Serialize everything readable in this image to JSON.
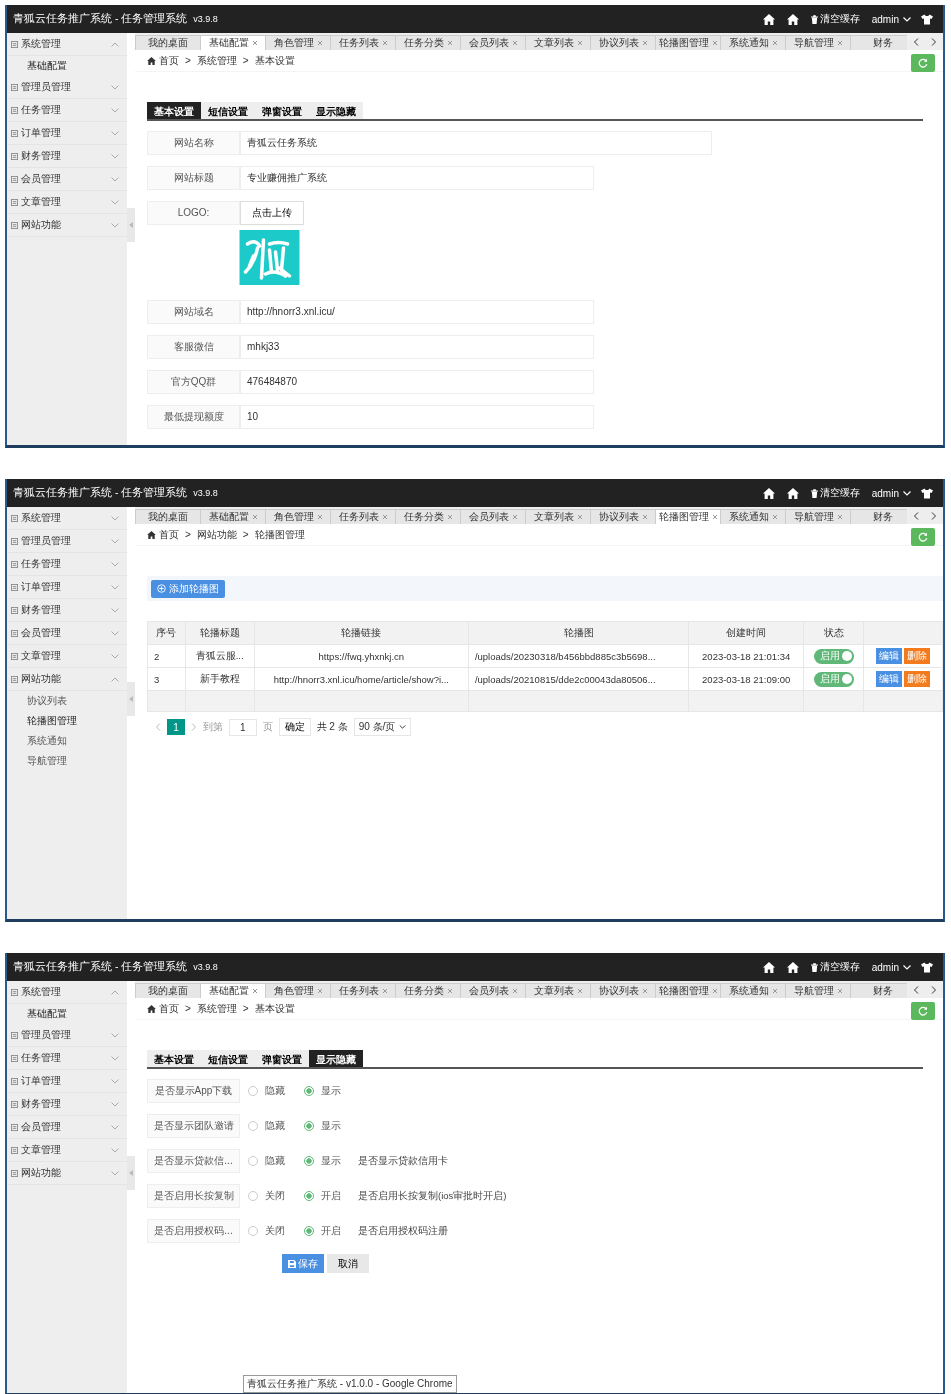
{
  "screens": [
    {
      "header": {
        "title": "青狐云任务推广系统 - 任务管理系统",
        "version": "v3.9.8",
        "clear_cache": "清空缓存",
        "user": "admin"
      },
      "sidebar": [
        {
          "label": "系统管理",
          "expanded": true,
          "children": [
            {
              "label": "基础配置",
              "selected": true
            }
          ]
        },
        {
          "label": "管理员管理",
          "expanded": false
        },
        {
          "label": "任务管理",
          "expanded": false
        },
        {
          "label": "订单管理",
          "expanded": false
        },
        {
          "label": "财务管理",
          "expanded": false
        },
        {
          "label": "会员管理",
          "expanded": false
        },
        {
          "label": "文章管理",
          "expanded": false
        },
        {
          "label": "网站功能",
          "expanded": false
        }
      ],
      "tabs": [
        {
          "label": "我的桌面",
          "selected": false,
          "closable": false
        },
        {
          "label": "基础配置",
          "selected": true,
          "closable": true
        },
        {
          "label": "角色管理",
          "selected": false,
          "closable": true
        },
        {
          "label": "任务列表",
          "selected": false,
          "closable": true
        },
        {
          "label": "任务分类",
          "selected": false,
          "closable": true
        },
        {
          "label": "会员列表",
          "selected": false,
          "closable": true
        },
        {
          "label": "文章列表",
          "selected": false,
          "closable": true
        },
        {
          "label": "协议列表",
          "selected": false,
          "closable": true
        },
        {
          "label": "轮播图管理",
          "selected": false,
          "closable": true
        },
        {
          "label": "系统通知",
          "selected": false,
          "closable": true
        },
        {
          "label": "导航管理",
          "selected": false,
          "closable": true
        },
        {
          "label": "财务",
          "selected": false,
          "closable": false
        }
      ],
      "breadcrumb": {
        "separator": ">",
        "items": [
          "首页",
          "系统管理",
          "基本设置"
        ]
      },
      "content": {
        "kind": "form",
        "subtabs": [
          {
            "label": "基本设置",
            "selected": true
          },
          {
            "label": "短信设置",
            "selected": false
          },
          {
            "label": "弹窗设置",
            "selected": false
          },
          {
            "label": "显示隐藏",
            "selected": false
          }
        ],
        "fields": [
          {
            "kind": "long",
            "label": "网站名称",
            "value": "青狐云任务系统"
          },
          {
            "kind": "text",
            "label": "网站标题",
            "value": "专业赚佣推广系统"
          },
          {
            "kind": "upload",
            "label": "LOGO:",
            "button": "点击上传"
          },
          {
            "kind": "text",
            "label": "网站域名",
            "value": "http://hnorr3.xnl.icu/"
          },
          {
            "kind": "text",
            "label": "客服微信",
            "value": "mhkj33"
          },
          {
            "kind": "text",
            "label": "官方QQ群",
            "value": "476484870"
          },
          {
            "kind": "text",
            "label": "最低提现额度",
            "value": "10"
          }
        ]
      }
    },
    {
      "header": {
        "title": "青狐云任务推广系统 - 任务管理系统",
        "version": "v3.9.8",
        "clear_cache": "清空缓存",
        "user": "admin"
      },
      "sidebar": [
        {
          "label": "系统管理",
          "expanded": false
        },
        {
          "label": "管理员管理",
          "expanded": false
        },
        {
          "label": "任务管理",
          "expanded": false
        },
        {
          "label": "订单管理",
          "expanded": false
        },
        {
          "label": "财务管理",
          "expanded": false
        },
        {
          "label": "会员管理",
          "expanded": false
        },
        {
          "label": "文章管理",
          "expanded": false
        },
        {
          "label": "网站功能",
          "expanded": true,
          "children": [
            {
              "label": "协议列表",
              "selected": false
            },
            {
              "label": "轮播图管理",
              "selected": true
            },
            {
              "label": "系统通知",
              "selected": false
            },
            {
              "label": "导航管理",
              "selected": false
            }
          ]
        }
      ],
      "tabs": [
        {
          "label": "我的桌面",
          "selected": false,
          "closable": false
        },
        {
          "label": "基础配置",
          "selected": false,
          "closable": true
        },
        {
          "label": "角色管理",
          "selected": false,
          "closable": true
        },
        {
          "label": "任务列表",
          "selected": false,
          "closable": true
        },
        {
          "label": "任务分类",
          "selected": false,
          "closable": true
        },
        {
          "label": "会员列表",
          "selected": false,
          "closable": true
        },
        {
          "label": "文章列表",
          "selected": false,
          "closable": true
        },
        {
          "label": "协议列表",
          "selected": false,
          "closable": true
        },
        {
          "label": "轮播图管理",
          "selected": true,
          "closable": true
        },
        {
          "label": "系统通知",
          "selected": false,
          "closable": true
        },
        {
          "label": "导航管理",
          "selected": false,
          "closable": true
        },
        {
          "label": "财务",
          "selected": false,
          "closable": false
        }
      ],
      "breadcrumb": {
        "separator": ">",
        "items": [
          "首页",
          "网站功能",
          "轮播图管理"
        ]
      },
      "content": {
        "kind": "table",
        "add_button": "添加轮播图",
        "columns": [
          "序号",
          "轮播标题",
          "轮播链接",
          "轮播图",
          "创建时间",
          "状态"
        ],
        "rows": [
          {
            "cells": [
              "2",
              "青狐云服...",
              "https://fwq.yhxnkj.cn",
              "/uploads/20230318/b456bbd885c3b5698...",
              "2023-03-18 21:01:34"
            ],
            "status": {
              "label": "启用",
              "on": true
            },
            "actions": [
              "编辑",
              "删除"
            ]
          },
          {
            "cells": [
              "3",
              "新手教程",
              "http://hnorr3.xnl.icu/home/article/show?i...",
              "/uploads/20210815/dde2c00043da80506...",
              "2023-03-18 21:09:00"
            ],
            "status": {
              "label": "启用",
              "on": true
            },
            "actions": [
              "编辑",
              "删除"
            ]
          }
        ],
        "pagination": {
          "page": "1",
          "goto": "到第",
          "input": "1",
          "unit": "页",
          "confirm": "确定",
          "total": "共 2 条",
          "per_page": "90 条/页"
        }
      }
    },
    {
      "header": {
        "title": "青狐云任务推广系统 - 任务管理系统",
        "version": "v3.9.8",
        "clear_cache": "清空缓存",
        "user": "admin"
      },
      "sidebar": [
        {
          "label": "系统管理",
          "expanded": true,
          "children": [
            {
              "label": "基础配置",
              "selected": true
            }
          ]
        },
        {
          "label": "管理员管理",
          "expanded": false
        },
        {
          "label": "任务管理",
          "expanded": false
        },
        {
          "label": "订单管理",
          "expanded": false
        },
        {
          "label": "财务管理",
          "expanded": false
        },
        {
          "label": "会员管理",
          "expanded": false
        },
        {
          "label": "文章管理",
          "expanded": false
        },
        {
          "label": "网站功能",
          "expanded": false
        }
      ],
      "tabs": [
        {
          "label": "我的桌面",
          "selected": false,
          "closable": false
        },
        {
          "label": "基础配置",
          "selected": true,
          "closable": true
        },
        {
          "label": "角色管理",
          "selected": false,
          "closable": true
        },
        {
          "label": "任务列表",
          "selected": false,
          "closable": true
        },
        {
          "label": "任务分类",
          "selected": false,
          "closable": true
        },
        {
          "label": "会员列表",
          "selected": false,
          "closable": true
        },
        {
          "label": "文章列表",
          "selected": false,
          "closable": true
        },
        {
          "label": "协议列表",
          "selected": false,
          "closable": true
        },
        {
          "label": "轮播图管理",
          "selected": false,
          "closable": true
        },
        {
          "label": "系统通知",
          "selected": false,
          "closable": true
        },
        {
          "label": "导航管理",
          "selected": false,
          "closable": true
        },
        {
          "label": "财务",
          "selected": false,
          "closable": false
        }
      ],
      "breadcrumb": {
        "separator": ">",
        "items": [
          "首页",
          "系统管理",
          "基本设置"
        ]
      },
      "content": {
        "kind": "form",
        "subtabs": [
          {
            "label": "基本设置",
            "selected": false
          },
          {
            "label": "短信设置",
            "selected": false
          },
          {
            "label": "弹窗设置",
            "selected": false
          },
          {
            "label": "显示隐藏",
            "selected": true
          }
        ],
        "fields": [
          {
            "kind": "radio",
            "label": "是否显示App下载",
            "options": [
              {
                "label": "隐藏",
                "selected": false
              },
              {
                "label": "显示",
                "selected": true
              }
            ]
          },
          {
            "kind": "radio",
            "label": "是否显示团队邀请",
            "options": [
              {
                "label": "隐藏",
                "selected": false
              },
              {
                "label": "显示",
                "selected": true
              }
            ]
          },
          {
            "kind": "radio",
            "label": "是否显示贷款信...",
            "options": [
              {
                "label": "隐藏",
                "selected": false
              },
              {
                "label": "显示",
                "selected": true
              }
            ],
            "note": "是否显示贷款信用卡"
          },
          {
            "kind": "radio",
            "label": "是否启用长按复制",
            "options": [
              {
                "label": "关闭",
                "selected": false
              },
              {
                "label": "开启",
                "selected": true
              }
            ],
            "note": "是否启用长按复制(ios审批时开启)"
          },
          {
            "kind": "radio",
            "label": "是否启用授权码...",
            "options": [
              {
                "label": "关闭",
                "selected": false
              },
              {
                "label": "开启",
                "selected": true
              }
            ],
            "note": "是否启用授权码注册"
          }
        ],
        "buttons": [
          {
            "label": "保存",
            "primary": true
          },
          {
            "label": "取消",
            "primary": false
          }
        ]
      },
      "tooltip": "青狐云任务推广系统 - v1.0.0 - Google Chrome"
    }
  ]
}
